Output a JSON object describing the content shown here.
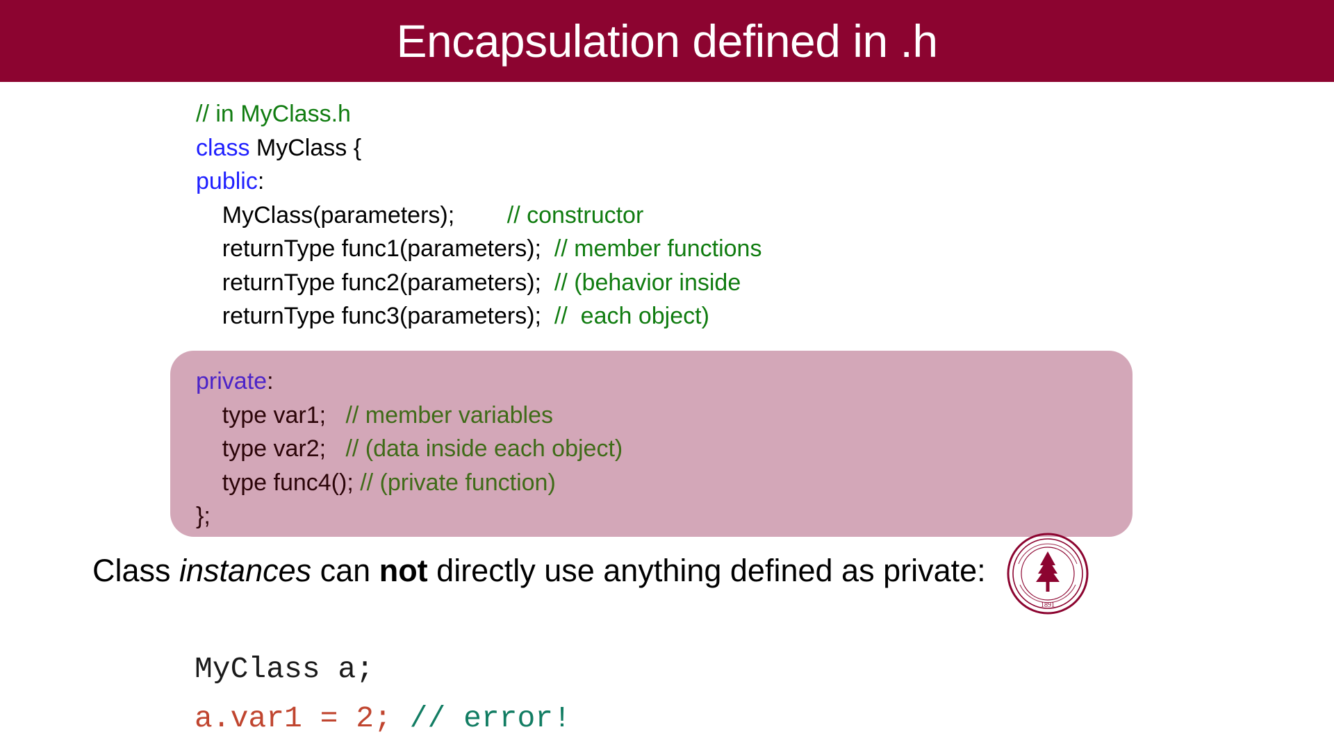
{
  "slide": {
    "title": "Encapsulation defined in .h",
    "title_bar_color": "#8c0430"
  },
  "code_public": {
    "lines": [
      {
        "indent": 0,
        "segments": [
          {
            "text": "// in MyClass.h",
            "style": "cmt"
          }
        ]
      },
      {
        "indent": 0,
        "segments": [
          {
            "text": "class",
            "style": "kw"
          },
          {
            "text": " MyClass {",
            "style": "plain"
          }
        ]
      },
      {
        "indent": 0,
        "segments": [
          {
            "text": "public",
            "style": "kw"
          },
          {
            "text": ":",
            "style": "plain"
          }
        ]
      },
      {
        "indent": 1,
        "segments": [
          {
            "text": "MyClass(parameters);        ",
            "style": "plain"
          },
          {
            "text": "// constructor",
            "style": "cmt"
          }
        ]
      },
      {
        "indent": 1,
        "segments": [
          {
            "text": "returnType func1(parameters);  ",
            "style": "plain"
          },
          {
            "text": "// member functions",
            "style": "cmt"
          }
        ]
      },
      {
        "indent": 1,
        "segments": [
          {
            "text": "returnType func2(parameters);  ",
            "style": "plain"
          },
          {
            "text": "// (behavior inside",
            "style": "cmt"
          }
        ]
      },
      {
        "indent": 1,
        "segments": [
          {
            "text": "returnType func3(parameters);  ",
            "style": "plain"
          },
          {
            "text": "//  each object)",
            "style": "cmt"
          }
        ]
      }
    ]
  },
  "code_private": {
    "highlight_color": "#d3a7b8",
    "lines": [
      {
        "indent": 0,
        "segments": [
          {
            "text": "private",
            "style": "kw-priv"
          },
          {
            "text": ":",
            "style": "plain-d"
          }
        ]
      },
      {
        "indent": 1,
        "segments": [
          {
            "text": "type var1;   ",
            "style": "plain-d"
          },
          {
            "text": "// member variables",
            "style": "cmt-dark"
          }
        ]
      },
      {
        "indent": 1,
        "segments": [
          {
            "text": "type var2;   ",
            "style": "plain-d"
          },
          {
            "text": "// (data inside each object)",
            "style": "cmt-dark"
          }
        ]
      },
      {
        "indent": 1,
        "segments": [
          {
            "text": "type func4(); ",
            "style": "plain-d"
          },
          {
            "text": "// (private function)",
            "style": "cmt-dark"
          }
        ]
      },
      {
        "indent": 0,
        "segments": [
          {
            "text": "};",
            "style": "plain-d"
          }
        ]
      }
    ]
  },
  "prose": {
    "part1": "Class ",
    "italic": "instances",
    "part2": " can ",
    "bold": "not",
    "part3": " directly use anything defined as private:"
  },
  "mono_code": {
    "lines": [
      {
        "segments": [
          {
            "text": "MyClass a;",
            "style": "m-black"
          }
        ]
      },
      {
        "segments": [
          {
            "text": "a.var1 = 2; ",
            "style": "m-red"
          },
          {
            "text": "// error!",
            "style": "m-teal"
          }
        ]
      }
    ]
  },
  "seal": {
    "label": "stanford-seal",
    "year": "1891",
    "color": "#8c0430"
  }
}
